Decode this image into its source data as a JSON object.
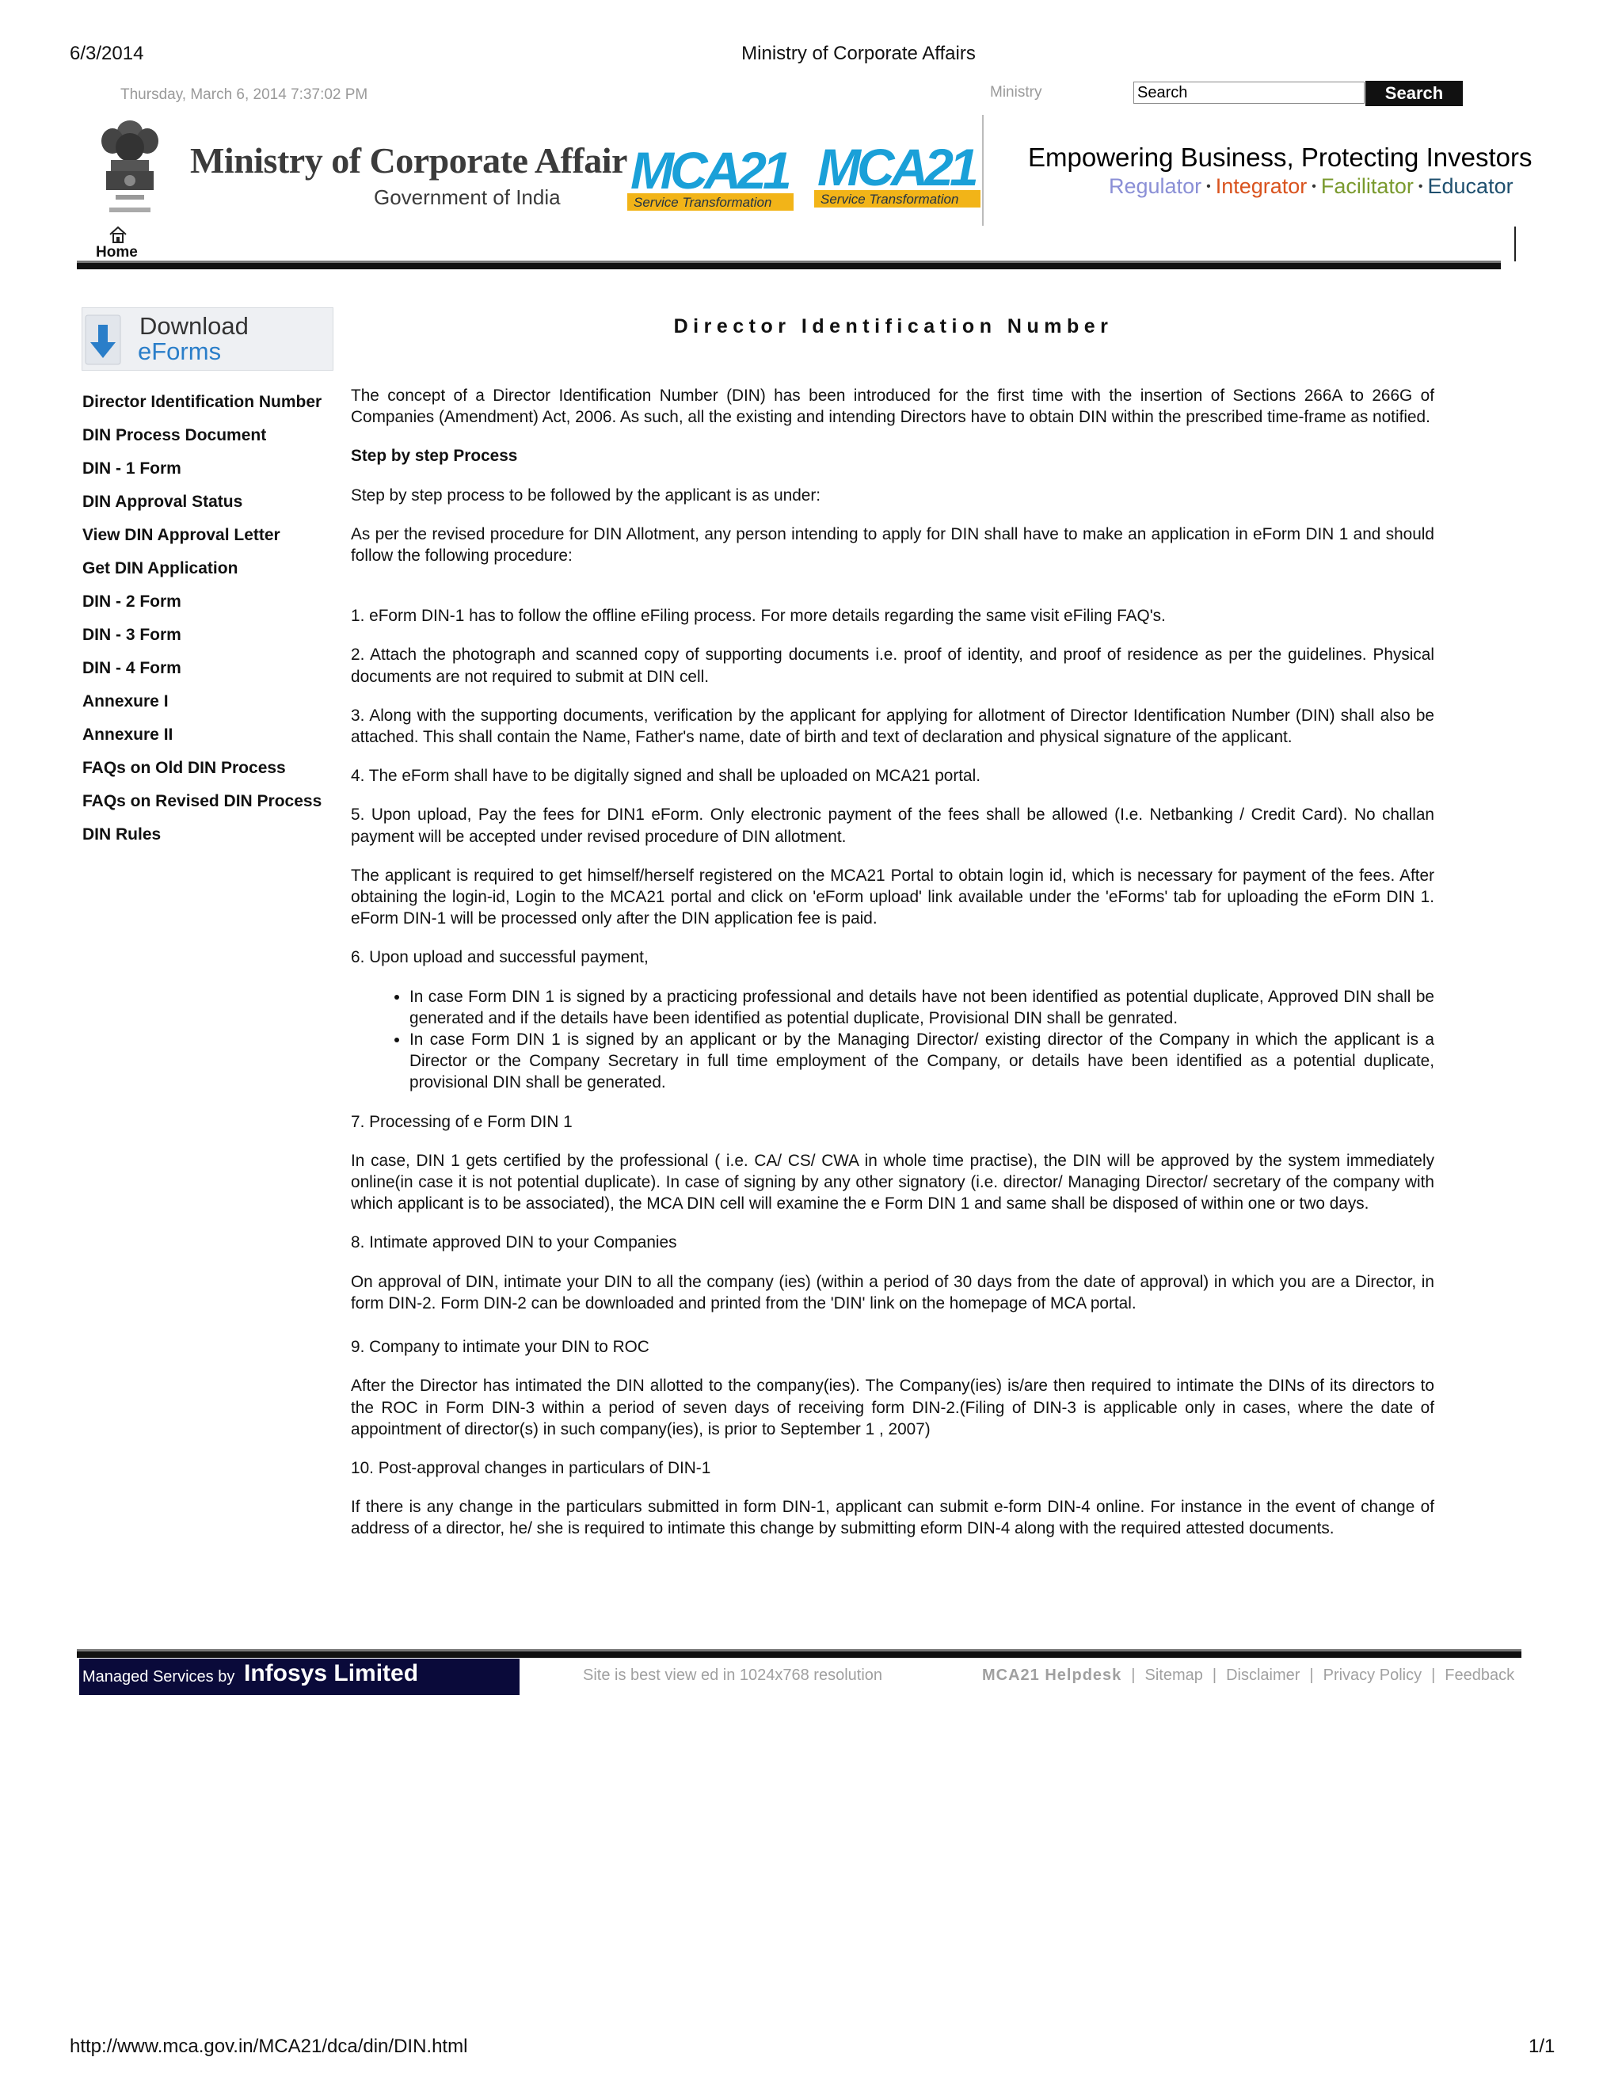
{
  "print": {
    "date": "6/3/2014",
    "title": "Ministry of Corporate Affairs",
    "url": "http://www.mca.gov.in/MCA21/dca/din/DIN.html",
    "page": "1/1"
  },
  "topbar": {
    "datetime": "Thursday, March 6, 2014 7:37:02 PM",
    "ministry_label": "Ministry",
    "search_value": "Search",
    "search_button": "Search"
  },
  "header": {
    "logo_title": "Ministry of Corporate Affairs",
    "logo_subtitle": "Government of India",
    "mca_logo_text": "MCA21",
    "mca_logo_caption": "Service Transformation",
    "tagline": "Empowering Business, Protecting Investors",
    "roles": [
      {
        "label": "Regulator",
        "color": "#8a8fd6"
      },
      {
        "label": "Integrator",
        "color": "#d9531e"
      },
      {
        "label": "Facilitator",
        "color": "#7a9a2e"
      },
      {
        "label": "Educator",
        "color": "#1e4f6e"
      }
    ],
    "home_label": "Home"
  },
  "sidebar": {
    "download_label": "Download",
    "eforms_label": "eForms",
    "items": [
      "Director Identification Number",
      "DIN Process Document",
      "DIN - 1 Form",
      "DIN Approval Status",
      "View DIN Approval Letter",
      "Get DIN Application",
      "DIN - 2 Form",
      "DIN - 3 Form",
      "DIN - 4 Form",
      "Annexure I",
      "Annexure II",
      "FAQs on Old DIN Process",
      "FAQs on Revised DIN Process",
      "DIN Rules"
    ]
  },
  "main": {
    "title": "Director Identification Number",
    "intro": "The concept of a Director Identification Number (DIN) has been introduced for the first time with the insertion of Sections 266A to 266G of Companies (Amendment) Act, 2006. As such, all the existing and intending Directors have to obtain DIN within the prescribed time-frame as notified.",
    "step_heading": "Step by step Process",
    "step_intro": "Step by step process to be followed by the applicant is as under:",
    "revised": "As per the revised procedure for DIN Allotment, any person intending to apply for DIN shall have to make an application in eForm DIN 1 and should follow the following procedure:",
    "s1": "1. eForm DIN-1 has to follow the offline eFiling process. For more details regarding the same visit eFiling FAQ's.",
    "s2": "2. Attach the photograph and scanned copy of supporting documents i.e. proof of identity, and proof of residence as per the guidelines. Physical documents are not required to submit at DIN cell.",
    "s3": "3. Along with the supporting documents, verification by the applicant for applying for allotment of Director Identification Number (DIN) shall also be attached. This shall contain the Name, Father's name, date of birth and text of declaration and physical signature of the applicant.",
    "s4": "4. The eForm shall have to be digitally signed and shall be uploaded on MCA21 portal.",
    "s5": "5. Upon upload, Pay the fees for DIN1 eForm. Only electronic payment of the fees shall be allowed (I.e. Netbanking / Credit Card). No challan payment will be accepted under revised procedure of DIN allotment.",
    "s5b": "The applicant is required to get himself/herself registered on the MCA21 Portal to obtain login id, which is necessary for payment of the fees. After obtaining the login-id, Login to the MCA21 portal and click on 'eForm upload' link available under the 'eForms' tab for uploading the eForm DIN 1. eForm DIN-1 will be processed only after the DIN application fee is paid.",
    "s6": "6. Upon upload and successful payment,",
    "s6_bullets": [
      "In case Form DIN 1 is signed by a practicing professional and details have not been identified as potential duplicate, Approved DIN shall be generated and if the details have been identified as potential duplicate, Provisional DIN shall be genrated.",
      "In case Form DIN 1 is signed by an applicant or by the Managing Director/ existing director of the Company in which the applicant is a Director or the Company Secretary in full time employment of the Company, or details have been identified as a potential duplicate, provisional DIN shall be generated."
    ],
    "s7": "7. Processing of e Form DIN 1",
    "s7b": "In case, DIN 1 gets certified by the professional ( i.e. CA/ CS/ CWA in whole time practise), the DIN will be approved by the system immediately online(in case it is not potential duplicate). In case of signing by any other signatory (i.e. director/ Managing Director/ secretary of the company with which applicant is to be associated), the MCA DIN cell will examine the e Form DIN 1 and same shall be disposed of within one or two days.",
    "s8": "8. Intimate approved DIN to your Companies",
    "s8b": "On approval of DIN, intimate your DIN to all the company (ies) (within a period of 30 days from the date of approval) in which you are a Director, in form DIN-2. Form DIN-2 can be downloaded and printed from the 'DIN' link on the homepage of MCA portal.",
    "s9": "9. Company to intimate your DIN to ROC",
    "s9b": "After the Director has intimated the DIN allotted to the company(ies). The Company(ies) is/are then required to intimate the DINs of its directors to the ROC in Form DIN-3 within a period of seven days of receiving form DIN-2.(Filing of DIN-3 is applicable only in cases, where the date of appointment of director(s) in such company(ies), is prior to September 1 , 2007)",
    "s10": "10. Post-approval changes in particulars of DIN-1",
    "s10b": "If there is any change in the particulars submitted in form DIN-1, applicant can submit e-form DIN-4 online. For instance in the event of change of address of a director, he/ she is required to intimate this change by submitting eform DIN-4 along with the required attested documents."
  },
  "footer": {
    "managed_small": "Managed Services by",
    "managed_big": "Infosys Limited",
    "best_viewed": "Site is best view ed in 1024x768 resolution",
    "links": [
      "MCA21 Helpdesk",
      "Sitemap",
      "Disclaimer",
      "Privacy Policy",
      "Feedback"
    ]
  }
}
